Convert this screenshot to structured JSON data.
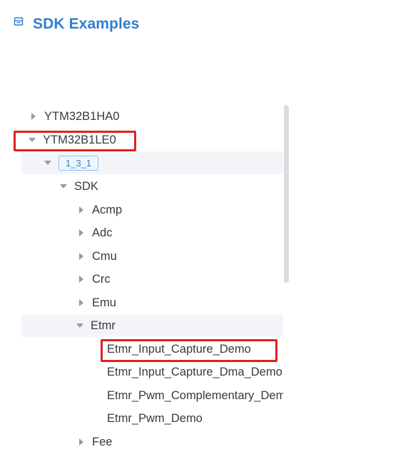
{
  "header": {
    "title": "SDK Examples",
    "icon": "sdk-box-icon"
  },
  "tree": {
    "chip_1": "YTM32B1HA0",
    "chip_2": "YTM32B1LE0",
    "version_tag": "1_3_1",
    "sdk": "SDK",
    "modules": {
      "acmp": "Acmp",
      "adc": "Adc",
      "cmu": "Cmu",
      "crc": "Crc",
      "emu": "Emu",
      "etmr": "Etmr",
      "fee": "Fee"
    },
    "etmr_demos": {
      "demo_1": "Etmr_Input_Capture_Demo",
      "demo_2": "Etmr_Input_Capture_Dma_Demo",
      "demo_3": "Etmr_Pwm_Complementary_Demo",
      "demo_4": "Etmr_Pwm_Demo"
    }
  },
  "colors": {
    "accent": "#2f7fd0",
    "highlight_box": "#e02020",
    "row_highlight": "#f3f5f9"
  }
}
